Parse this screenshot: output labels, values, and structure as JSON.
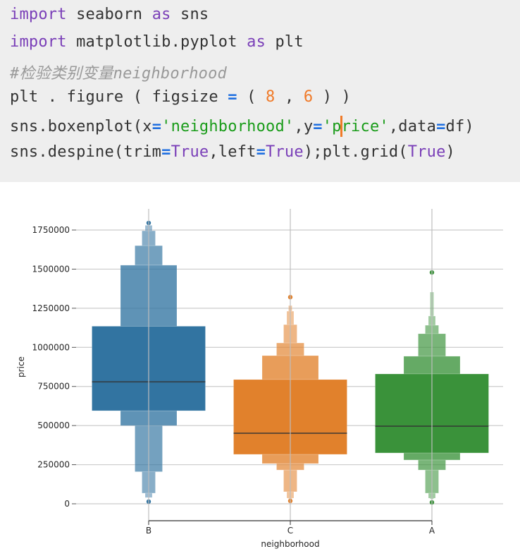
{
  "code": {
    "lines": [
      [
        {
          "t": "import",
          "c": "kw"
        },
        {
          "t": " seaborn "
        },
        {
          "t": "as",
          "c": "kw"
        },
        {
          "t": " sns"
        }
      ],
      [
        {
          "t": "import",
          "c": "kw"
        },
        {
          "t": " matplotlib.pyplot "
        },
        {
          "t": "as",
          "c": "kw"
        },
        {
          "t": " plt"
        }
      ],
      [
        {
          "t": "#检验类别变量neighborhood",
          "c": "cmt"
        }
      ],
      [
        {
          "t": "plt . figure ( figsize "
        },
        {
          "t": "=",
          "c": "op"
        },
        {
          "t": " ( "
        },
        {
          "t": "8",
          "c": "num"
        },
        {
          "t": " , "
        },
        {
          "t": "6",
          "c": "num"
        },
        {
          "t": " ) )"
        }
      ],
      [
        {
          "t": "sns.boxenplot(x"
        },
        {
          "t": "=",
          "c": "op"
        },
        {
          "t": "'neighborhood'",
          "c": "str"
        },
        {
          "t": ",y"
        },
        {
          "t": "=",
          "c": "op"
        },
        {
          "t": "'p",
          "c": "str"
        },
        {
          "t": "",
          "caret": true
        },
        {
          "t": "rice'",
          "c": "str"
        },
        {
          "t": ",data"
        },
        {
          "t": "=",
          "c": "op"
        },
        {
          "t": "df)"
        }
      ],
      [
        {
          "t": "sns.despine(trim"
        },
        {
          "t": "=",
          "c": "op"
        },
        {
          "t": "True",
          "c": "kw"
        },
        {
          "t": ",left"
        },
        {
          "t": "=",
          "c": "op"
        },
        {
          "t": "True",
          "c": "kw"
        },
        {
          "t": ");plt.grid("
        },
        {
          "t": "True",
          "c": "kw"
        },
        {
          "t": ")"
        }
      ]
    ]
  },
  "chart_data": {
    "type": "boxen",
    "title": "",
    "xlabel": "neighborhood",
    "ylabel": "price",
    "categories": [
      "B",
      "C",
      "A"
    ],
    "ylim": [
      0,
      1750000
    ],
    "yticks": [
      0,
      250000,
      500000,
      750000,
      1000000,
      1250000,
      1500000,
      1750000
    ],
    "ytick_labels": [
      "0",
      "250000",
      "500000",
      "750000",
      "1000000",
      "1250000",
      "1500000",
      "1750000"
    ],
    "grid": true,
    "series": [
      {
        "name": "B",
        "color": "#3274a1",
        "median": 780000,
        "levels": [
          {
            "low": 595000,
            "high": 1135000
          },
          {
            "low": 500000,
            "high": 1525000
          },
          {
            "low": 205000,
            "high": 1650000
          },
          {
            "low": 68000,
            "high": 1745000
          },
          {
            "low": 40000,
            "high": 1780000
          }
        ],
        "outliers": [
          1795000,
          14000
        ]
      },
      {
        "name": "C",
        "color": "#e1812c",
        "median": 451000,
        "levels": [
          {
            "low": 316000,
            "high": 794000
          },
          {
            "low": 257000,
            "high": 947000
          },
          {
            "low": 216000,
            "high": 1028000
          },
          {
            "low": 77000,
            "high": 1145000
          },
          {
            "low": 36000,
            "high": 1231000
          },
          {
            "low": 30000,
            "high": 1267000
          }
        ],
        "outliers": [
          1321000,
          18000
        ]
      },
      {
        "name": "A",
        "color": "#3a923a",
        "median": 496000,
        "levels": [
          {
            "low": 325000,
            "high": 830000
          },
          {
            "low": 280000,
            "high": 943000
          },
          {
            "low": 216000,
            "high": 1087000
          },
          {
            "low": 68000,
            "high": 1141000
          },
          {
            "low": 36000,
            "high": 1200000
          },
          {
            "low": 30000,
            "high": 1353000
          }
        ],
        "outliers": [
          1479000,
          9000
        ]
      }
    ]
  }
}
